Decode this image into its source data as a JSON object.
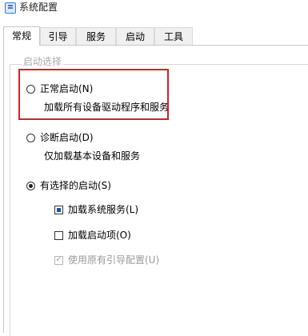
{
  "window": {
    "title": "系统配置",
    "icon": "msconfig-icon"
  },
  "tabs": [
    {
      "label": "常规",
      "active": true
    },
    {
      "label": "引导",
      "active": false
    },
    {
      "label": "服务",
      "active": false
    },
    {
      "label": "启动",
      "active": false
    },
    {
      "label": "工具",
      "active": false
    }
  ],
  "startup_selection": {
    "label": "启动选择",
    "normal": {
      "label": "正常启动(N)",
      "description": "加载所有设备驱动程序和服务",
      "checked": false
    },
    "diagnostic": {
      "label": "诊断启动(D)",
      "description": "仅加载基本设备和服务",
      "checked": false
    },
    "selective": {
      "label": "有选择的启动(S)",
      "checked": true,
      "options": {
        "load_system_services": {
          "label": "加载系统服务(L)",
          "state": "indeterminate"
        },
        "load_startup_items": {
          "label": "加载启动项(O)",
          "state": "unchecked"
        },
        "use_original_boot_config": {
          "label": "使用原有引导配置(U)",
          "state": "checked-disabled"
        }
      }
    }
  },
  "annotation": {
    "highlight_color": "#d81e28"
  }
}
